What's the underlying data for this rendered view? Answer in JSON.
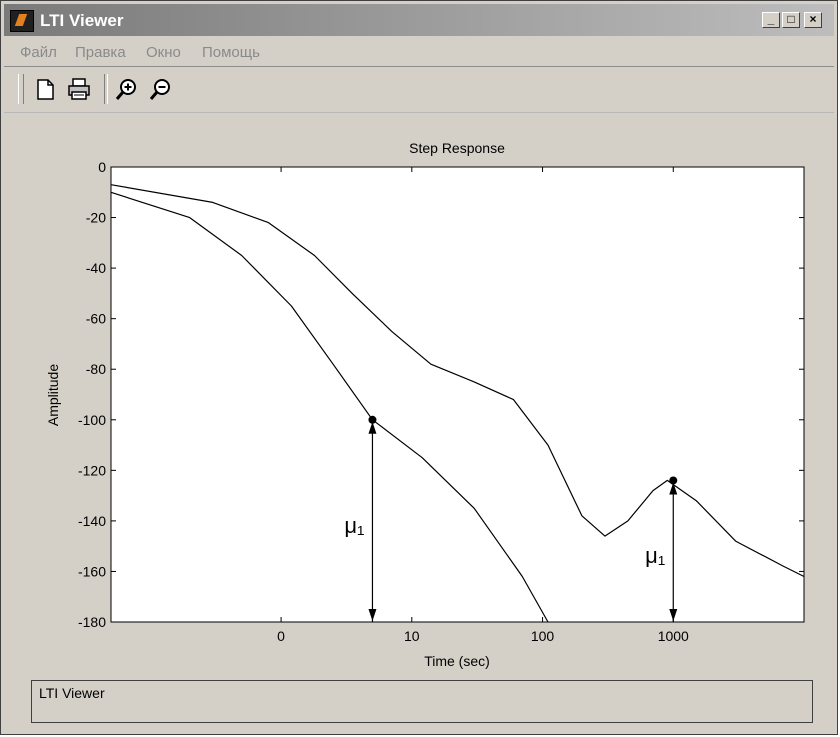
{
  "window": {
    "title": "LTI Viewer"
  },
  "menu": {
    "items": [
      "Файл",
      "Правка",
      "Окно",
      "Помощь"
    ]
  },
  "toolbar": {
    "icons": [
      "new-file-icon",
      "print-icon",
      "zoom-in-icon",
      "zoom-out-icon"
    ]
  },
  "colors": {
    "window_bg": "#d4d0c8",
    "title_bar_start": "#7a7a7a",
    "plot_bg": "#ffffff",
    "line": "#000000"
  },
  "status": {
    "text": "LTI Viewer"
  },
  "chart_data": {
    "type": "line",
    "title": "Step Response",
    "xlabel": "Time (sec)",
    "ylabel": "Amplitude",
    "ylim": [
      -180,
      0
    ],
    "yticks": [
      0,
      -20,
      -40,
      -60,
      -80,
      -100,
      -120,
      -140,
      -160,
      -180
    ],
    "xticks": [
      "0",
      "10",
      "100",
      "1000"
    ],
    "grid": false,
    "series": [
      {
        "points": [
          [
            0.05,
            -7
          ],
          [
            0.3,
            -14
          ],
          [
            0.8,
            -22
          ],
          [
            1.8,
            -35
          ],
          [
            3.5,
            -50
          ],
          [
            7,
            -65
          ],
          [
            14,
            -78
          ],
          [
            30,
            -85
          ],
          [
            60,
            -92
          ],
          [
            110,
            -110
          ],
          [
            200,
            -138
          ],
          [
            300,
            -146
          ],
          [
            450,
            -140
          ],
          [
            700,
            -128
          ],
          [
            900,
            -124
          ],
          [
            1500,
            -132
          ],
          [
            3000,
            -148
          ],
          [
            7000,
            -158
          ],
          [
            10000,
            -162
          ]
        ]
      },
      {
        "points": [
          [
            0.05,
            -10
          ],
          [
            0.2,
            -20
          ],
          [
            0.5,
            -35
          ],
          [
            1.2,
            -55
          ],
          [
            2.5,
            -78
          ],
          [
            5,
            -100
          ],
          [
            12,
            -115
          ],
          [
            30,
            -135
          ],
          [
            70,
            -162
          ],
          [
            110,
            -180
          ]
        ]
      }
    ],
    "annotations": [
      {
        "label": "μ₁",
        "x": 5,
        "y_top": -100,
        "y_bottom": -180
      },
      {
        "label": "μ₁",
        "x": 1000,
        "y_top": -124,
        "y_bottom": -180
      }
    ]
  }
}
